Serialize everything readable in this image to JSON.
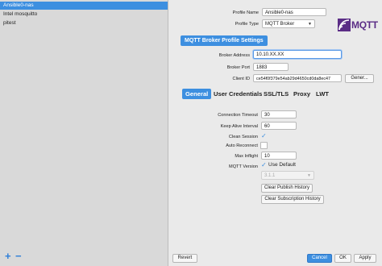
{
  "sidebar": {
    "profiles": [
      {
        "label": "Ansible0-nas",
        "selected": true
      },
      {
        "label": "Intel mosquitto",
        "selected": false
      },
      {
        "label": "pitest",
        "selected": false
      }
    ],
    "add_label": "+",
    "remove_label": "−"
  },
  "profile": {
    "name_label": "Profile Name",
    "name_value": "Ansible0-nas",
    "type_label": "Profile Type",
    "type_value": "MQTT Broker",
    "logo_text": "MQTT"
  },
  "broker": {
    "section_title": "MQTT Broker Profile Settings",
    "address_label": "Broker Address",
    "address_value": "10.10.XX.XX",
    "port_label": "Broker Port",
    "port_value": "1883",
    "client_id_label": "Client ID",
    "client_id_value": "ce54f0f379e54ab29d4650cd0da8ec47",
    "generate_label": "Gener..."
  },
  "tabs": [
    {
      "label": "General",
      "active": true
    },
    {
      "label": "User Credentials",
      "active": false
    },
    {
      "label": "SSL/TLS",
      "active": false
    },
    {
      "label": "Proxy",
      "active": false
    },
    {
      "label": "LWT",
      "active": false
    }
  ],
  "general": {
    "connection_timeout_label": "Connection Timeout",
    "connection_timeout_value": "30",
    "keep_alive_label": "Keep Alive Interval",
    "keep_alive_value": "60",
    "clean_session_label": "Clean Session",
    "clean_session_checked": true,
    "auto_reconnect_label": "Auto Reconnect",
    "auto_reconnect_checked": false,
    "max_inflight_label": "Max Inflight",
    "max_inflight_value": "10",
    "mqtt_version_label": "MQTT Version",
    "use_default_label": "Use Default",
    "use_default_checked": true,
    "version_value": "3.1.1",
    "clear_publish_label": "Clear Publish History",
    "clear_subscription_label": "Clear Subscription History"
  },
  "footer": {
    "revert_label": "Revert",
    "cancel_label": "Cancel",
    "ok_label": "OK",
    "apply_label": "Apply"
  },
  "colors": {
    "accent": "#3d8fe0",
    "logo": "#5b2d86"
  }
}
